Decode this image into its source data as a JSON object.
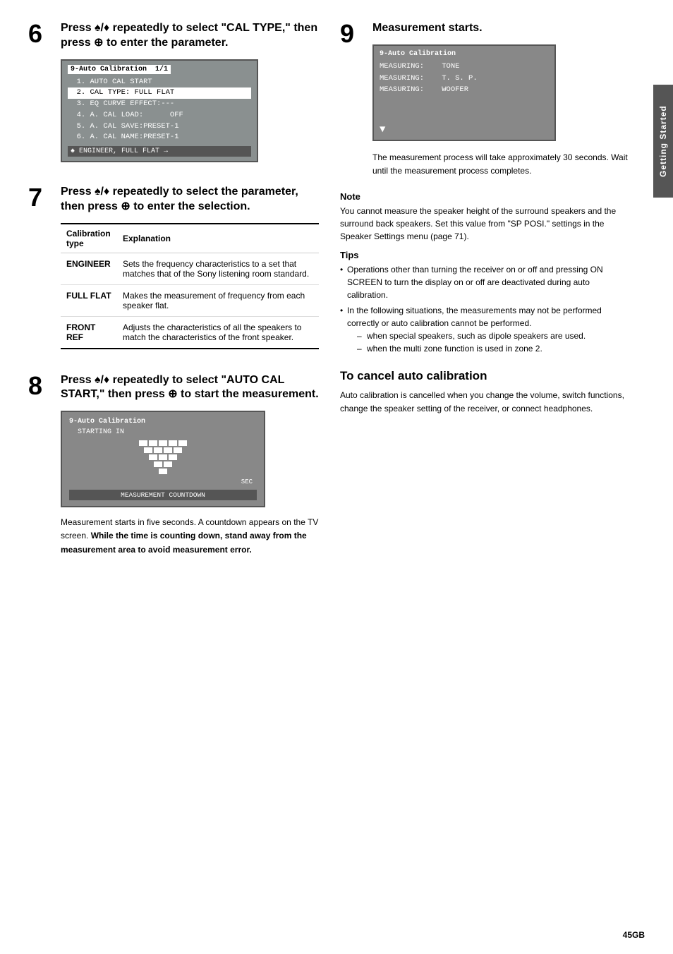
{
  "page": {
    "number": "45GB",
    "sidebar_label": "Getting Started"
  },
  "steps": {
    "step6": {
      "number": "6",
      "title": "Press ♠/♦ repeatedly to select \"CAL TYPE,\" then press ⊕ to enter the parameter.",
      "screen": {
        "title": "9-Auto Calibration  1/1",
        "lines": [
          "  1. AUTO CAL START",
          "  2. CAL TYPE: FULL FLAT",
          "  3. EQ CURVE EFFECT:---",
          "  4. A. CAL LOAD:      OFF",
          "  5. A. CAL SAVE:PRESET-1",
          "  6. A. CAL NAME:PRESET-1"
        ],
        "highlighted_line": "  2. CAL TYPE: FULL FLAT",
        "bottom": "♠ ENGINEER, FULL FLAT →"
      }
    },
    "step7": {
      "number": "7",
      "title": "Press ♠/♦ repeatedly to select the parameter, then press ⊕ to enter the selection.",
      "table": {
        "col1_header": "Calibration type",
        "col2_header": "Explanation",
        "rows": [
          {
            "type": "ENGINEER",
            "explanation": "Sets the frequency characteristics to a set that matches that of the Sony listening room standard."
          },
          {
            "type": "FULL FLAT",
            "explanation": "Makes the measurement of frequency from each speaker flat."
          },
          {
            "type": "FRONT REF",
            "explanation": "Adjusts the characteristics of all the speakers to match the characteristics of the front speaker."
          }
        ]
      }
    },
    "step8": {
      "number": "8",
      "title": "Press ♠/♦ repeatedly to select \"AUTO CAL START,\" then press ⊕ to start the measurement.",
      "screen2": {
        "title": "9-Auto Calibration",
        "starting": "STARTING IN",
        "sec_label": "SEC",
        "bottom": "MEASUREMENT COUNTDOWN"
      },
      "description": "Measurement starts in five seconds. A countdown appears on the TV screen. While the time is counting down, stand away from the measurement area to avoid measurement error."
    },
    "step9": {
      "number": "9",
      "title": "Measurement starts.",
      "screen3": {
        "title": "9-Auto Calibration",
        "lines": [
          "MEASURING:    TONE",
          "MEASURING:    T. S. P.",
          "MEASURING:    WOOFER"
        ]
      },
      "description": "The measurement process will take approximately 30 seconds. Wait until the measurement process completes."
    }
  },
  "note": {
    "title": "Note",
    "text": "You cannot measure the speaker height of the surround speakers and the surround back speakers. Set this value from \"SP POSI.\" settings in the Speaker Settings menu (page 71)."
  },
  "tips": {
    "title": "Tips",
    "items": [
      "Operations other than turning the receiver on or off and pressing ON SCREEN to turn the display on or off are deactivated during auto calibration.",
      "In the following situations, the measurements may not be performed correctly or auto calibration cannot be performed."
    ],
    "sub_items": [
      "when special speakers, such as dipole speakers are used.",
      "when the multi zone function is used in zone 2."
    ]
  },
  "cancel": {
    "title": "To cancel auto calibration",
    "text": "Auto calibration is cancelled when you change the volume, switch functions, change the speaker setting of the receiver, or connect headphones."
  }
}
